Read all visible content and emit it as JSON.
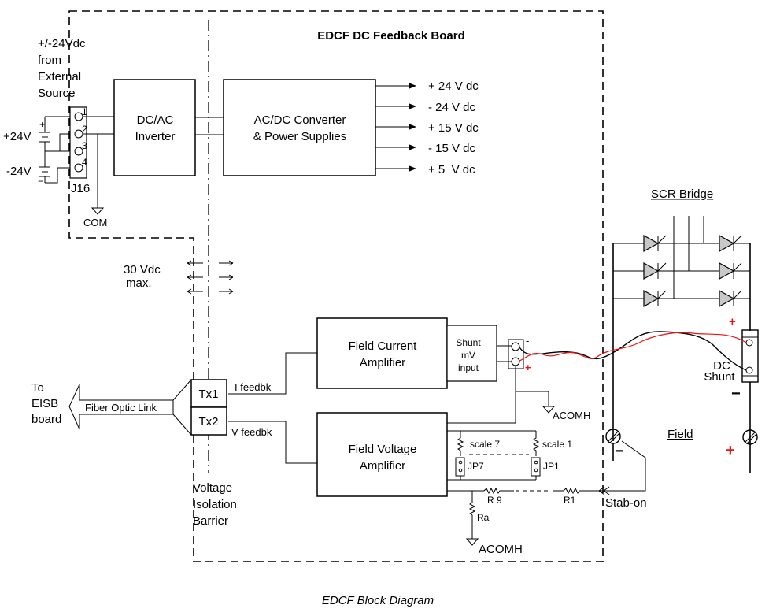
{
  "board": {
    "title": "EDCF DC Feedback Board",
    "caption": "EDCF Block Diagram"
  },
  "external_source": {
    "label_lines": [
      "+/-24Vdc",
      "from",
      "External",
      "Source"
    ],
    "pos_label": "+24V",
    "neg_label": "-24V",
    "connector": "J16",
    "pins": [
      "1",
      "2",
      "3",
      "4"
    ],
    "ground": "COM"
  },
  "blocks": {
    "inverter": [
      "DC/AC",
      "Inverter"
    ],
    "converter": [
      "AC/DC Converter",
      "& Power Supplies"
    ],
    "field_current_amp": [
      "Field Current",
      "Amplifier"
    ],
    "shunt_input": [
      "Shunt",
      "mV",
      "input"
    ],
    "field_voltage_amp": [
      "Field Voltage",
      "Amplifier"
    ],
    "tx1": "Tx1",
    "tx2": "Tx2"
  },
  "supply_outputs": [
    "+ 24 V dc",
    "- 24 V dc",
    "+ 15 V dc",
    "- 15 V dc",
    "+ 5  V dc"
  ],
  "isolation": {
    "max_label": [
      "30 Vdc",
      "max."
    ],
    "barrier_label": [
      "Voltage",
      "Isolation",
      "Barrier"
    ]
  },
  "fiber": {
    "link_label": "Fiber Optic Link",
    "destination": [
      "To",
      "EISB",
      "board"
    ],
    "i_feedback": "I feedbk",
    "v_feedback": "V feedbk"
  },
  "voltage_network": {
    "scale7": "scale 7",
    "scale1": "scale 1",
    "jp7": "JP7",
    "jp1": "JP1",
    "r9": "R 9",
    "r1": "R1",
    "ra": "Ra",
    "ground": "ACOMH",
    "stab_on": "Stab-on"
  },
  "shunt_terminal": {
    "neg": "-",
    "pos": "+",
    "ground": "ACOMH"
  },
  "power_section": {
    "scr_title": "SCR Bridge",
    "dc_shunt": [
      "DC",
      "Shunt"
    ],
    "field_label": "Field",
    "plus": "+",
    "minus": "−"
  },
  "colors": {
    "signal_red": "#ee1111",
    "scr_fill": "#c8c8c8"
  }
}
